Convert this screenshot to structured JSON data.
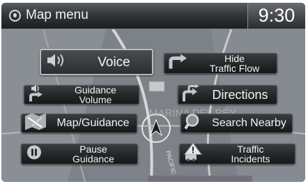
{
  "header": {
    "title": "Map menu",
    "time": "9:30"
  },
  "map": {
    "labels": [
      "MARINA DEL REY",
      "PACIFIC"
    ]
  },
  "menu": {
    "voice": "Voice",
    "hide_traffic_flow": "Hide\nTraffic Flow",
    "guidance_volume": "Guidance\nVolume",
    "directions": "Directions",
    "map_guidance": "Map/Guidance",
    "search_nearby": "Search Nearby",
    "pause_guidance": "Pause\nGuidance",
    "traffic_incidents": "Traffic\nIncidents"
  },
  "icons": [
    "speaker-icon",
    "turn-arrow-icon",
    "volume-turn-icon",
    "directions-icon",
    "map-guidance-icon",
    "search-icon",
    "pause-icon",
    "traffic-incident-icon"
  ],
  "colors": {
    "button": "#222426",
    "map": "#7d8288",
    "text": "#f4f4f4"
  }
}
